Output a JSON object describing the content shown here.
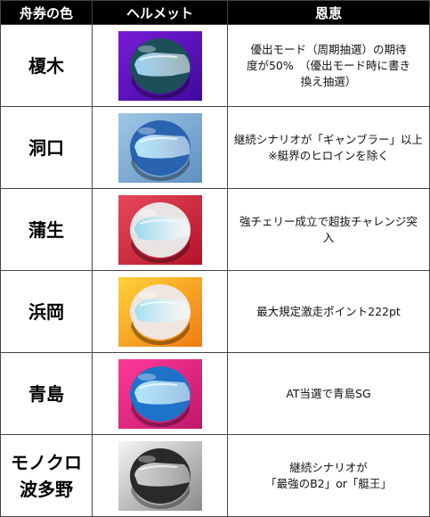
{
  "header": {
    "col1": "舟券の色",
    "col2": "ヘルメット",
    "col3": "恩恵"
  },
  "rows": [
    {
      "name_line1": "榎木",
      "name_line2": "",
      "benefit_line1": "優出モード（周期抽選）の期待",
      "benefit_line2": "度が50%　（優出モード時に書き",
      "benefit_line3": "換え抽選）",
      "bg_from": "#7a1bd6",
      "bg_to": "#3f0a9e",
      "shell": "#1d4f5a",
      "visor": "#9fd8ff"
    },
    {
      "name_line1": "洞口",
      "name_line2": "",
      "benefit_line1": "継続シナリオが「ギャンブラー」以上",
      "benefit_line2": "※艇界のヒロインを除く",
      "benefit_line3": "",
      "bg_from": "#9fc7e6",
      "bg_to": "#5f8fc2",
      "shell": "#2a63b0",
      "visor": "#b8f0ff"
    },
    {
      "name_line1": "蒲生",
      "name_line2": "",
      "benefit_line1": "強チェリー成立で超抜チャレンジ突",
      "benefit_line2": "入",
      "benefit_line3": "",
      "bg_from": "#e8485a",
      "bg_to": "#b3122a",
      "shell": "#e9e4e4",
      "visor": "#8fd8f0"
    },
    {
      "name_line1": "浜岡",
      "name_line2": "",
      "benefit_line1": "最大規定激走ポイント222pt",
      "benefit_line2": "",
      "benefit_line3": "",
      "bg_from": "#ffd23a",
      "bg_to": "#f07a12",
      "shell": "#f0e6df",
      "visor": "#9ae0f5"
    },
    {
      "name_line1": "青島",
      "name_line2": "",
      "benefit_line1": "AT当選で青島SG",
      "benefit_line2": "",
      "benefit_line3": "",
      "bg_from": "#ff3a9a",
      "bg_to": "#c0166a",
      "shell": "#1e72c8",
      "visor": "#b6ecff"
    },
    {
      "name_line1": "モノクロ",
      "name_line2": "波多野",
      "benefit_line1": "継続シナリオが",
      "benefit_line2": "「最強のB2」or「艇王」",
      "benefit_line3": "",
      "bg_from": "#f4f4f4",
      "bg_to": "#8a8a8a",
      "shell": "#2a2a2a",
      "visor": "#d8d8d8"
    }
  ]
}
